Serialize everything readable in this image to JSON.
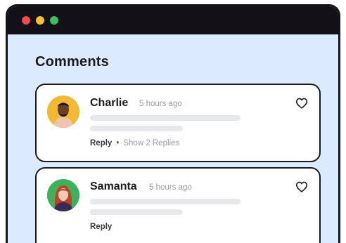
{
  "window": {
    "controls": {
      "close_color": "#f04a4a",
      "minimize_color": "#f6c02e",
      "maximize_color": "#39c25b"
    }
  },
  "page": {
    "title": "Comments"
  },
  "comments": [
    {
      "author": "Charlie",
      "time": "5 hours ago",
      "reply_label": "Reply",
      "separator": "•",
      "show_replies_label": "Show 2 Replies",
      "avatar_bg": "#f4b934",
      "like_icon": "heart-icon"
    },
    {
      "author": "Samanta",
      "time": "5 hours ago",
      "reply_label": "Reply",
      "avatar_bg": "#3fb15c",
      "like_icon": "heart-icon"
    }
  ]
}
